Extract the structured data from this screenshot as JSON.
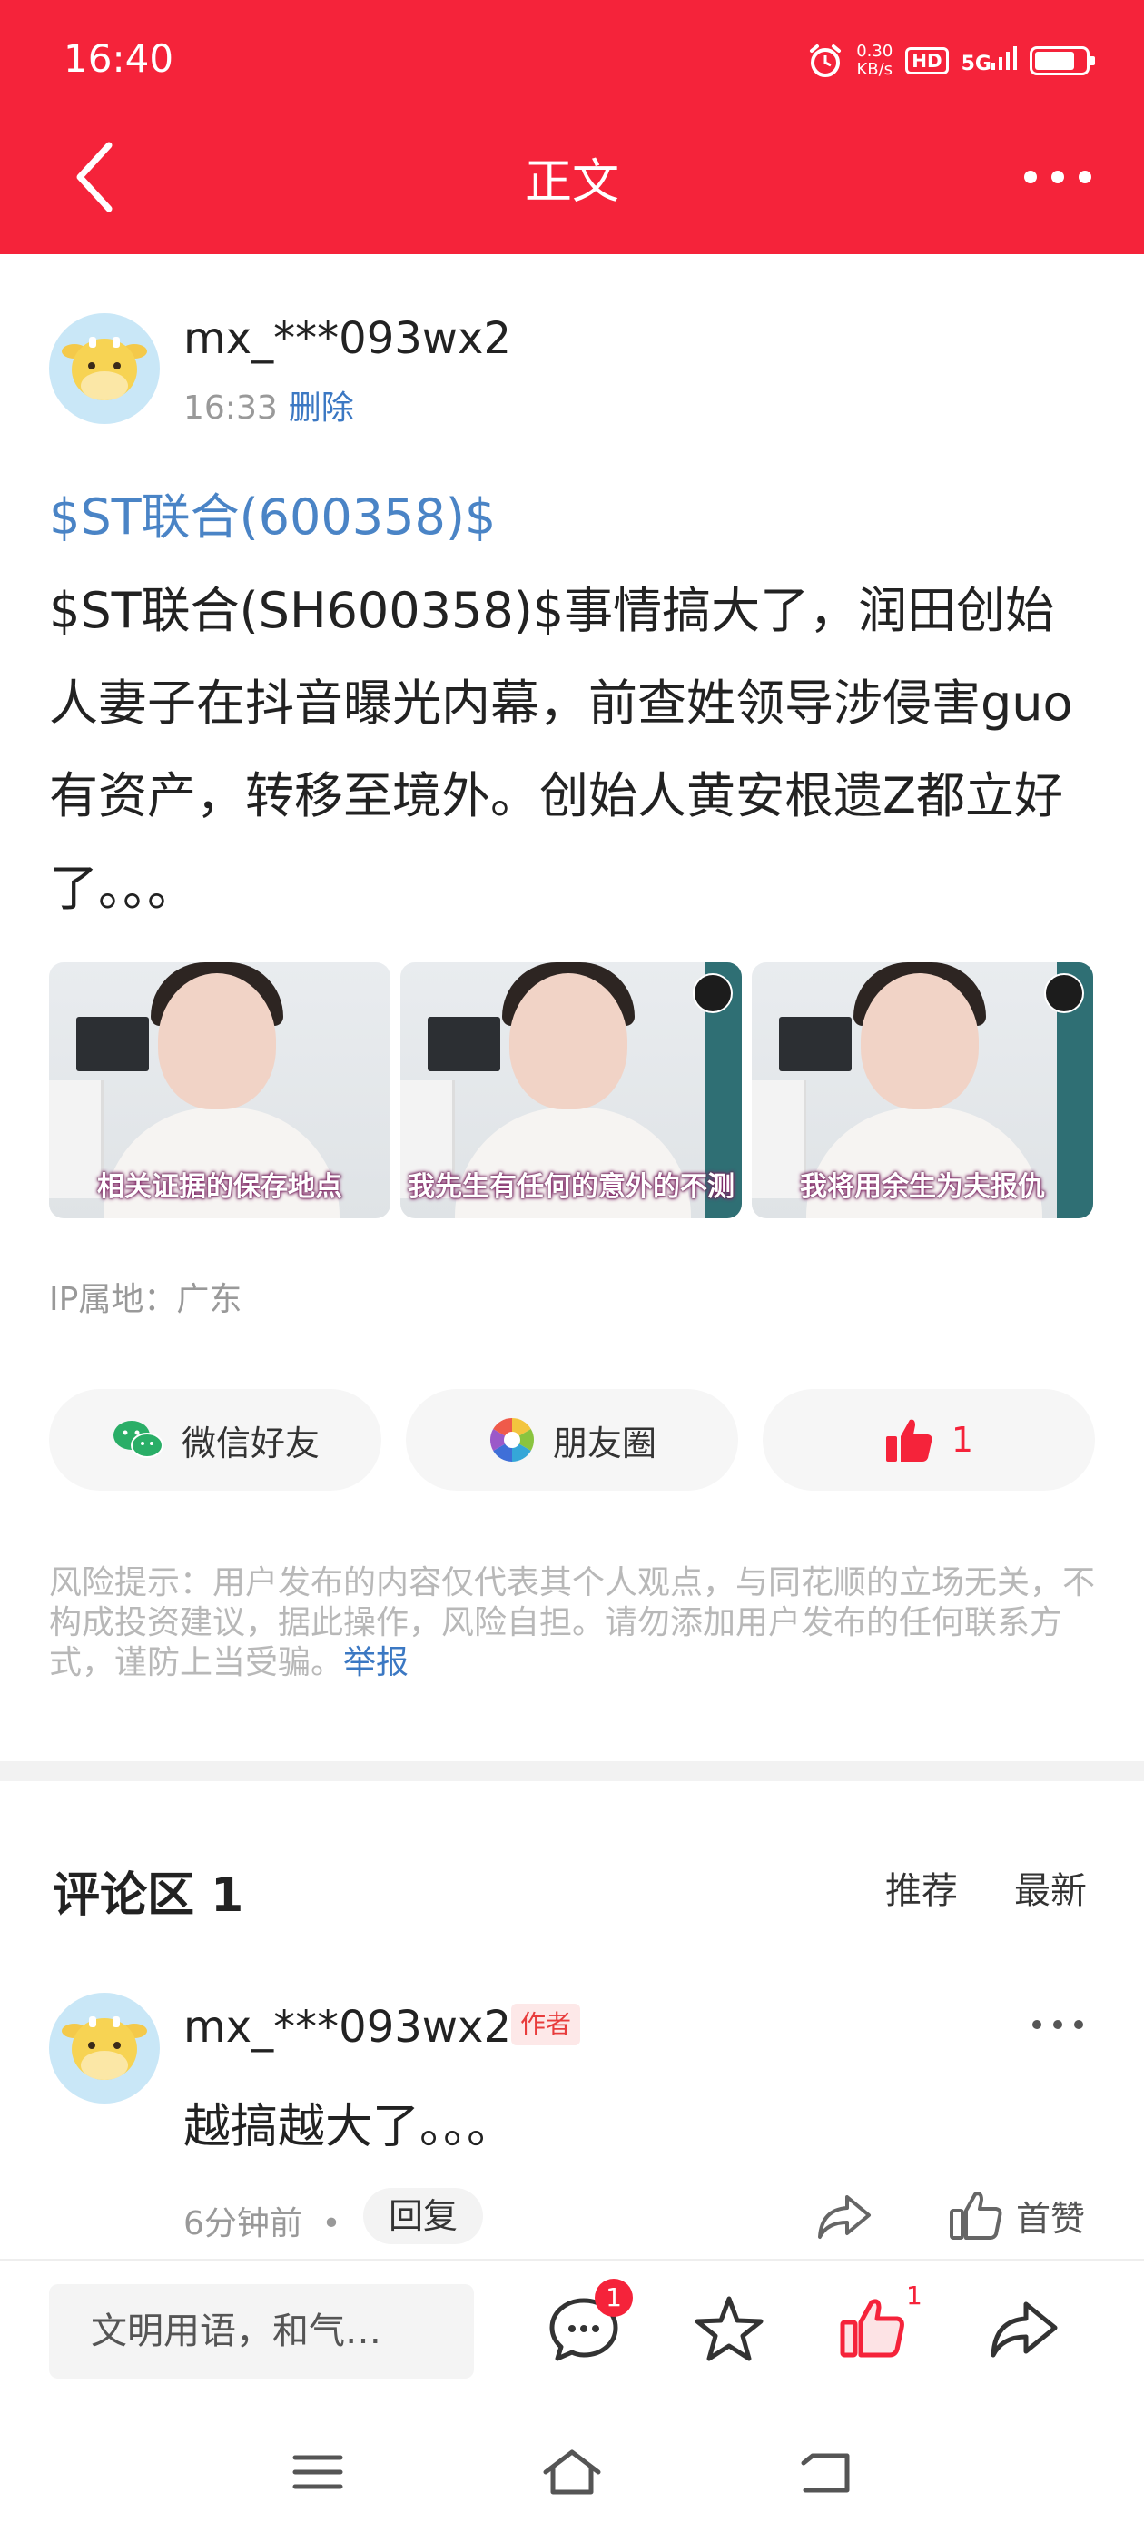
{
  "status_bar": {
    "time": "16:40",
    "net_speed_value": "0.30",
    "net_speed_unit": "KB/s",
    "hd": "HD",
    "signal": "5G",
    "battery_level": 0.8,
    "icons": [
      "alarm-icon",
      "hd-icon",
      "signal-5g-icon",
      "battery-icon"
    ]
  },
  "header": {
    "title": "正文",
    "back_icon": "chevron-left-icon",
    "more_icon": "more-icon"
  },
  "colors": {
    "brand_red": "#f5233a",
    "link_blue": "#3b78c3",
    "stock_blue": "#4a84c6",
    "muted_gray": "#999999"
  },
  "post": {
    "author": "mx_***093wx2",
    "time": "16:33",
    "delete_label": "删除",
    "stock_tag": "$ST联合(600358)$",
    "body": "$ST联合(SH600358)$事情搞大了，润田创始人妻子在抖音曝光内幕，前查姓领导涉侵害guo有资产，转移至境外。创始人黄安根遗Z都立好了。。。",
    "images": [
      {
        "caption": "相关证据的保存地点"
      },
      {
        "caption": "我先生有任何的意外的不测"
      },
      {
        "caption": "我将用余生为夫报仇"
      }
    ],
    "ip_location": "IP属地：广东"
  },
  "share": {
    "wechat_label": "微信好友",
    "moments_label": "朋友圈",
    "like_count": "1"
  },
  "risk": {
    "text": "风险提示：用户发布的内容仅代表其个人观点，与同花顺的立场无关，不构成投资建议，据此操作，风险自担。请勿添加用户发布的任何联系方式，谨防上当受骗。",
    "report_label": "举报"
  },
  "comments": {
    "title": "评论区 1",
    "sort_recommend": "推荐",
    "sort_latest": "最新",
    "items": [
      {
        "author": "mx_***093wx2",
        "tag": "作者",
        "text": "越搞越大了。。。",
        "time": "6分钟前",
        "reply_label": "回复",
        "like_label": "首赞"
      }
    ]
  },
  "bottom_bar": {
    "input_placeholder": "文明用语，和气…",
    "comment_badge": "1",
    "like_badge": "1"
  },
  "nav_bar": {
    "icons": [
      "menu-icon",
      "home-icon",
      "back-icon"
    ]
  }
}
